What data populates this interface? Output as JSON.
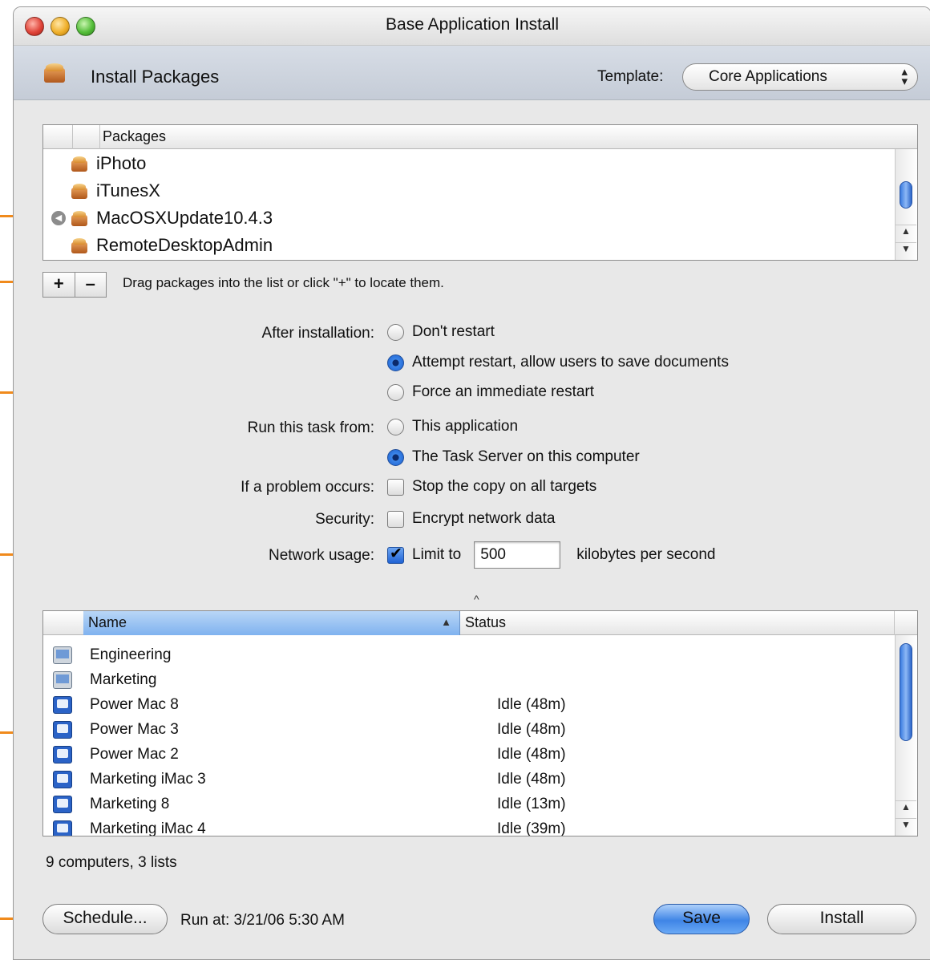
{
  "window": {
    "title": "Base Application Install"
  },
  "toolbar": {
    "title": "Install Packages",
    "template_label": "Template:",
    "template_value": "Core Applications"
  },
  "packages": {
    "header": "Packages",
    "items": [
      {
        "label": "iPhoto"
      },
      {
        "label": "iTunesX"
      },
      {
        "label": "MacOSXUpdate10.4.3"
      },
      {
        "label": "RemoteDesktopAdmin"
      }
    ],
    "add_label": "+",
    "remove_label": "–",
    "hint": "Drag packages into the list or click \"+\" to locate them."
  },
  "options": {
    "after_install_label": "After installation:",
    "after_install_options": [
      {
        "label": "Don't restart",
        "selected": false
      },
      {
        "label": "Attempt restart, allow users to save documents",
        "selected": true
      },
      {
        "label": "Force an immediate restart",
        "selected": false
      }
    ],
    "run_from_label": "Run this task from:",
    "run_from_options": [
      {
        "label": "This application",
        "selected": false
      },
      {
        "label": "The Task Server on this computer",
        "selected": true
      }
    ],
    "problem_label": "If a problem occurs:",
    "problem_option": {
      "label": "Stop the copy on all targets",
      "checked": false
    },
    "security_label": "Security:",
    "security_option": {
      "label": "Encrypt network data",
      "checked": false
    },
    "network_label": "Network usage:",
    "network_option": {
      "label": "Limit to",
      "checked": true,
      "value": "500",
      "unit": "kilobytes per second"
    }
  },
  "computers": {
    "sort_indicator": "^",
    "col_name": "Name",
    "col_status": "Status",
    "rows": [
      {
        "name": "Engineering",
        "status": "",
        "icon": "computer-list-icon"
      },
      {
        "name": "Marketing",
        "status": "",
        "icon": "computer-list-icon"
      },
      {
        "name": "Power Mac 8",
        "status": "Idle (48m)",
        "icon": "computer-icon"
      },
      {
        "name": "Power Mac 3",
        "status": "Idle (48m)",
        "icon": "computer-icon"
      },
      {
        "name": "Power Mac 2",
        "status": "Idle (48m)",
        "icon": "computer-icon"
      },
      {
        "name": "Marketing iMac 3",
        "status": "Idle (48m)",
        "icon": "computer-icon"
      },
      {
        "name": "Marketing 8",
        "status": "Idle (13m)",
        "icon": "computer-icon"
      },
      {
        "name": "Marketing iMac 4",
        "status": "Idle (39m)",
        "icon": "computer-icon"
      }
    ],
    "summary": "9 computers, 3 lists"
  },
  "footer": {
    "schedule_label": "Schedule...",
    "run_at": "Run at: 3/21/06 5:30 AM",
    "save_label": "Save",
    "install_label": "Install"
  },
  "colors": {
    "callout": "#f08a1c",
    "selection": "#3d86e8"
  }
}
